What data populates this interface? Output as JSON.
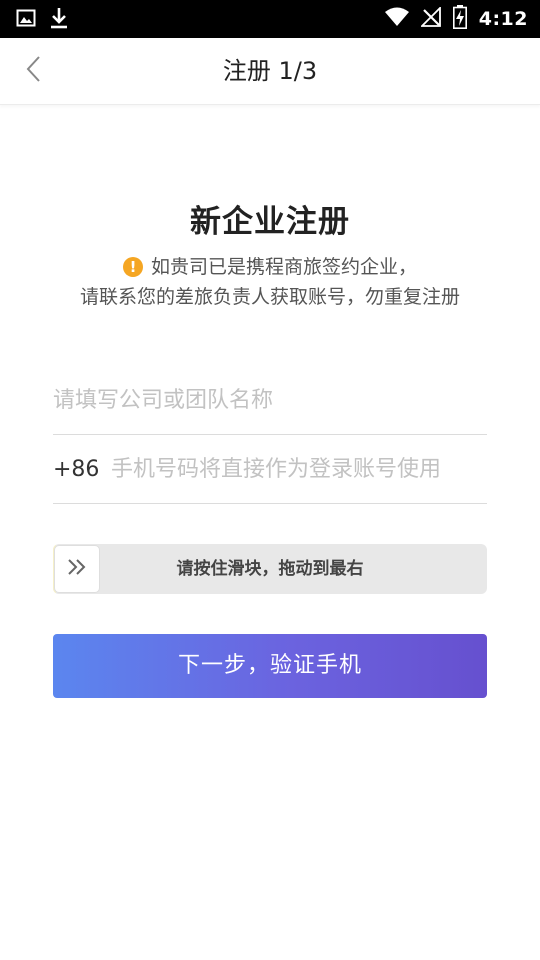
{
  "status_bar": {
    "time": "4:12",
    "left_icons": [
      "image-icon",
      "download-icon"
    ],
    "right_icons": [
      "wifi-icon",
      "no-signal-icon",
      "battery-charging-icon"
    ]
  },
  "header": {
    "title": "注册 1/3",
    "back_icon": "chevron-left-icon"
  },
  "main": {
    "heading": "新企业注册",
    "notice_line1": "如贵司已是携程商旅签约企业，",
    "notice_line2": "请联系您的差旅负责人获取账号，勿重复注册",
    "notice_icon": "warning-icon",
    "company_placeholder": "请填写公司或团队名称",
    "company_value": "",
    "country_code": "+86",
    "phone_placeholder": "手机号码将直接作为登录账号使用",
    "phone_value": "",
    "slider_text": "请按住滑块，拖动到最右",
    "slider_progress": 0,
    "next_button": "下一步，验证手机"
  },
  "colors": {
    "warning": "#f5a623",
    "button_gradient_start": "#5b86ef",
    "button_gradient_end": "#6650cf"
  }
}
